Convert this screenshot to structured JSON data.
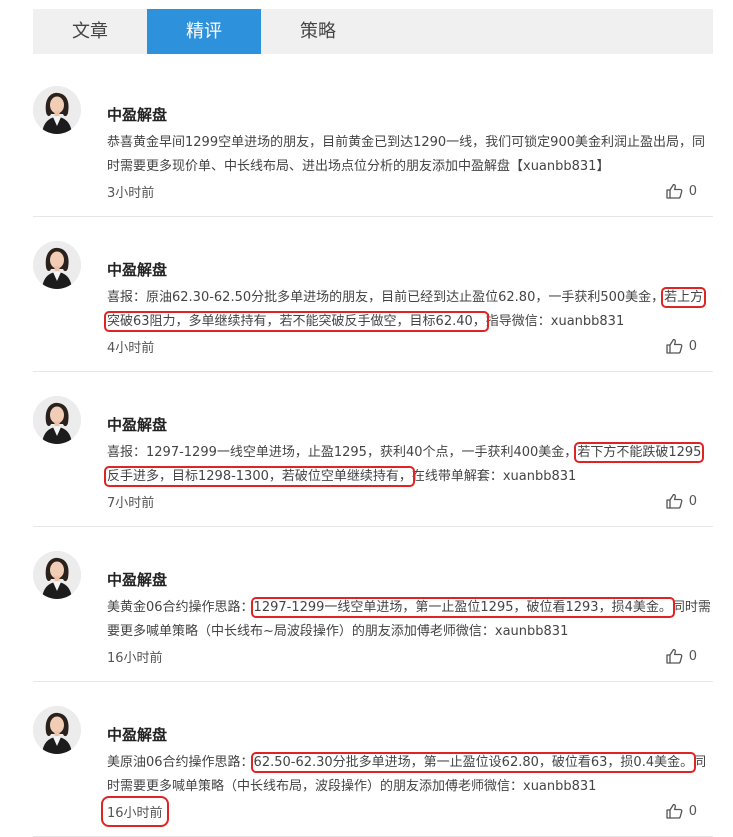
{
  "tabs": [
    {
      "label": "文章",
      "active": false
    },
    {
      "label": "精评",
      "active": true
    },
    {
      "label": "策略",
      "active": false
    }
  ],
  "accent_color": "#2d91db",
  "highlight_color": "#e02424",
  "posts": [
    {
      "author": "中盈解盘",
      "segments": [
        {
          "text": "恭喜黄金早间1299空单进场的朋友，目前黄金已到达1290一线，我们可锁定900美金利润止盈出局，同时需要更多现价单、中长线布局、进出场点位分析的朋友添加中盈解盘【xuanbb831】",
          "hl": false
        }
      ],
      "time": "3小时前",
      "likes": "0"
    },
    {
      "author": "中盈解盘",
      "segments": [
        {
          "text": "喜报：原油62.30-62.50分批多单进场的朋友，目前已经到达止盈位62.80，一手获利500美金，",
          "hl": false
        },
        {
          "text": "若上方突破63阻力，多单继续持有，若不能突破反手做空，目标62.40，",
          "hl": true
        },
        {
          "text": "指导微信：xuanbb831",
          "hl": false
        }
      ],
      "time": "4小时前",
      "likes": "0"
    },
    {
      "author": "中盈解盘",
      "segments": [
        {
          "text": "喜报：1297-1299一线空单进场，止盈1295，获利40个点，一手获利400美金，",
          "hl": false
        },
        {
          "text": "若下方不能跌破1295反手进多，目标1298-1300，若破位空单继续持有，",
          "hl": true
        },
        {
          "text": "在线带单解套：xuanbb831",
          "hl": false
        }
      ],
      "time": "7小时前",
      "likes": "0"
    },
    {
      "author": "中盈解盘",
      "segments": [
        {
          "text": "美黄金06合约操作思路：",
          "hl": false
        },
        {
          "text": "1297-1299一线空单进场，第一止盈位1295，破位看1293，损4美金。",
          "hl": true
        },
        {
          "text": "同时需要更多喊单策略（中长线布~局波段操作）的朋友添加傅老师微信：xaunbb831",
          "hl": false
        }
      ],
      "time": "16小时前",
      "likes": "0"
    },
    {
      "author": "中盈解盘",
      "segments": [
        {
          "text": "美原油06合约操作思路：",
          "hl": false
        },
        {
          "text": "62.50-62.30分批多单进场，第一止盈位设62.80，破位看63，损0.4美金。",
          "hl": true
        },
        {
          "text": "同时需要更多喊单策略（中长线布局，波段操作）的朋友添加傅老师微信：xuanbb831",
          "hl": false
        }
      ],
      "time": "16小时前",
      "time_highlighted": true,
      "likes": "0"
    }
  ]
}
